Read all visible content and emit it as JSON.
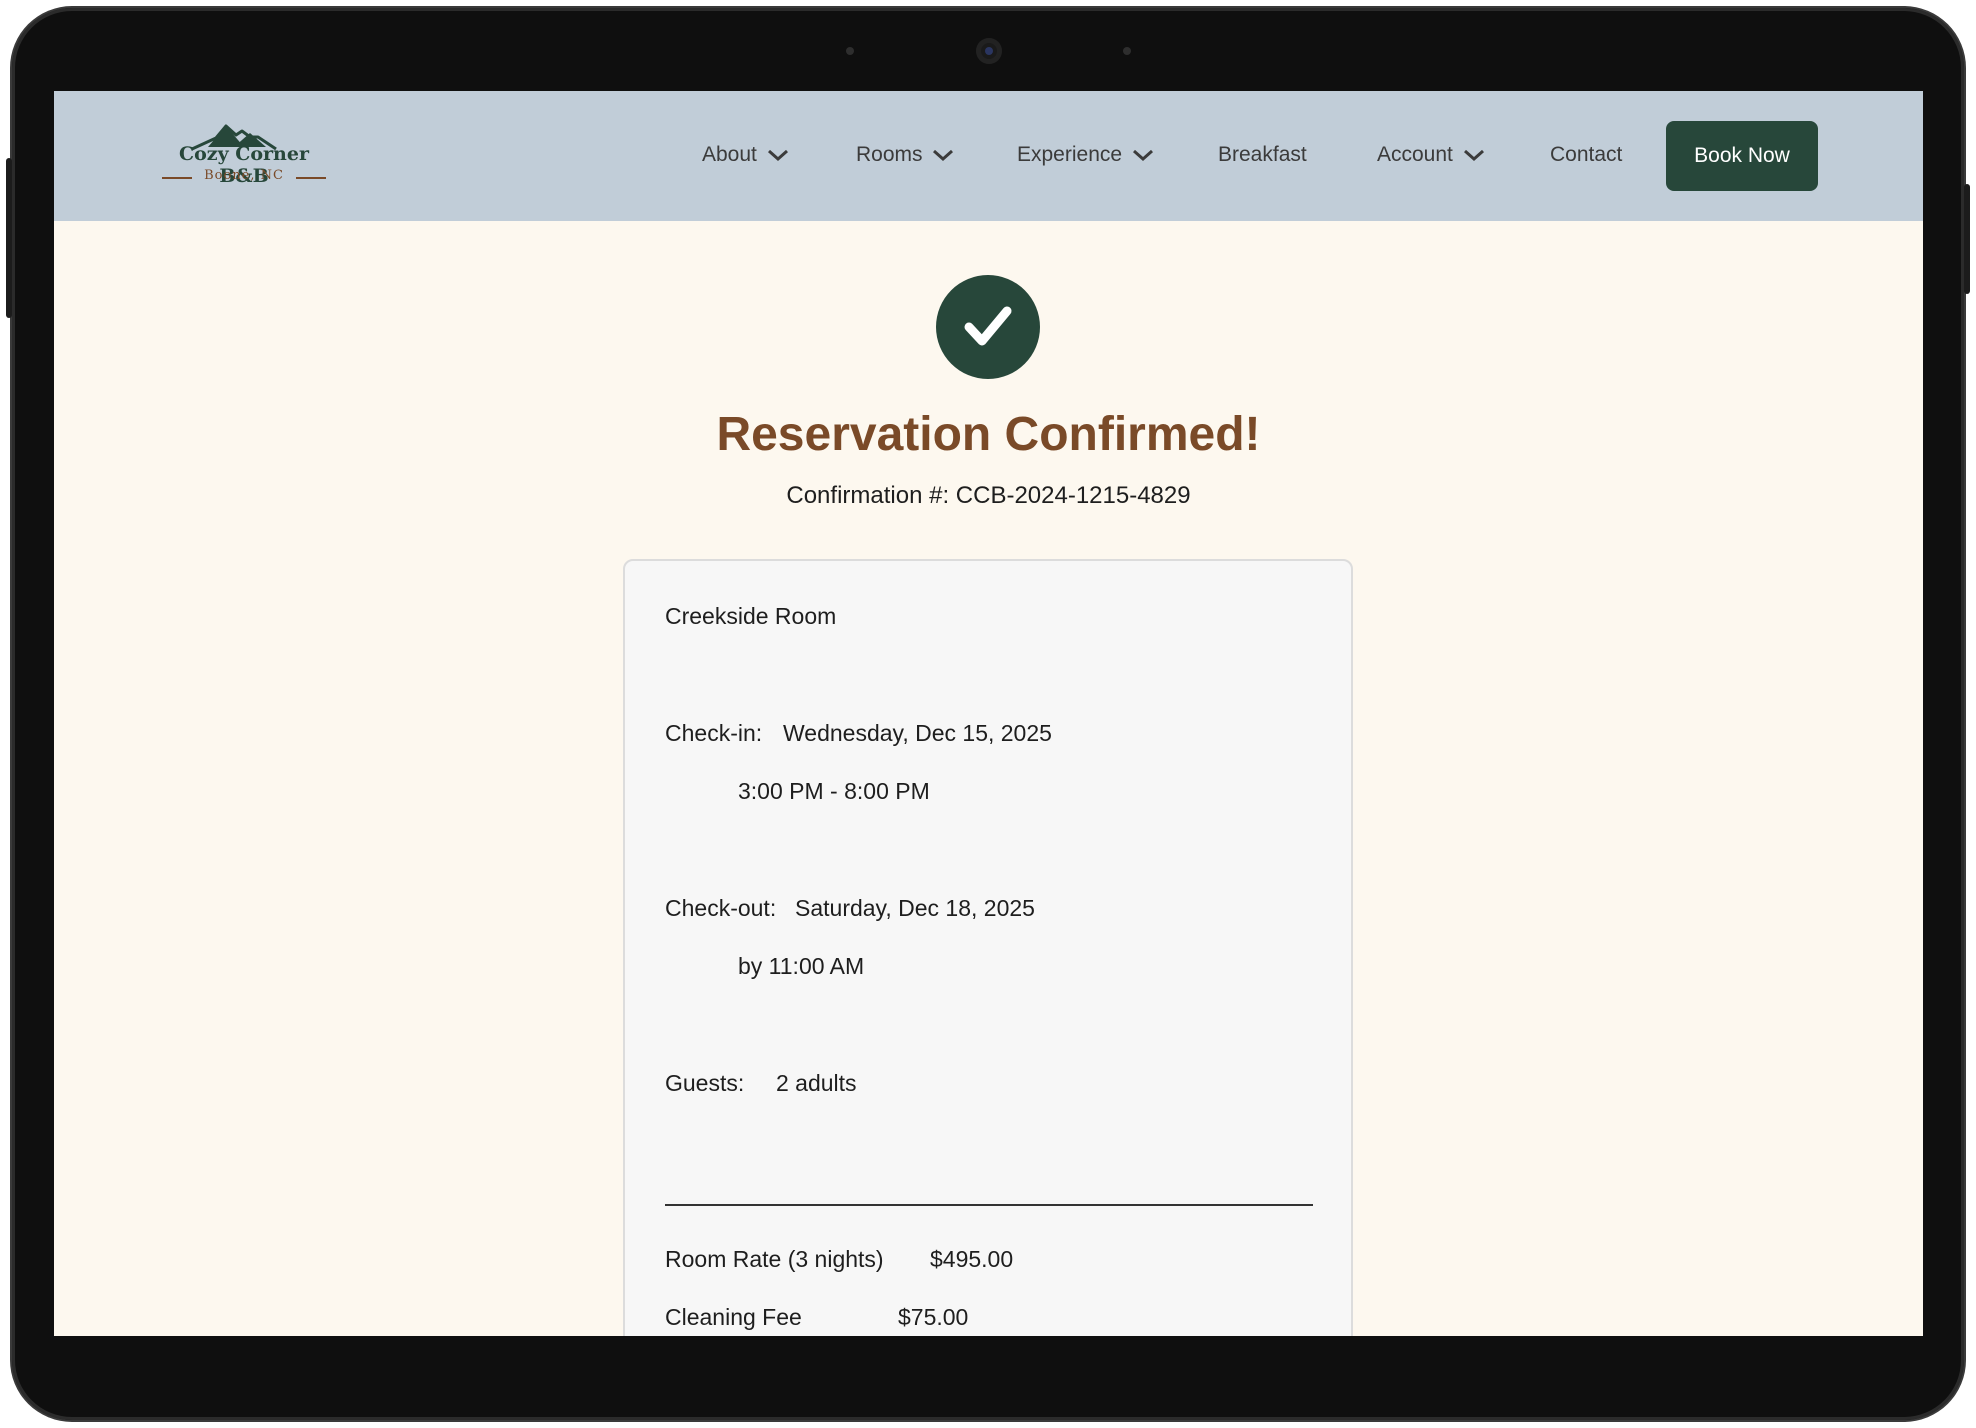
{
  "nav": {
    "brand_name": "Cozy Corner B&B",
    "brand_location": "Boone, NC",
    "items": [
      {
        "label": "About",
        "dropdown": true
      },
      {
        "label": "Rooms",
        "dropdown": true
      },
      {
        "label": "Experience",
        "dropdown": true
      },
      {
        "label": "Breakfast",
        "dropdown": false
      },
      {
        "label": "Account",
        "dropdown": true
      },
      {
        "label": "Contact",
        "dropdown": false
      }
    ],
    "cta_label": "Book Now"
  },
  "confirmation": {
    "icon": "check-circle-icon",
    "title": "Reservation Confirmed!",
    "number_text": "Confirmation #: CCB-2024-1215-4829"
  },
  "details": {
    "room_name": "Creekside Room",
    "checkin_label": "Check-in:",
    "checkin_date": "Wednesday, Dec 15, 2025",
    "checkin_time": "3:00 PM - 8:00 PM",
    "checkout_label": "Check-out:",
    "checkout_date": "Saturday, Dec 18, 2025",
    "checkout_time": "by 11:00 AM",
    "guests_label": "Guests:",
    "guests_value": "2 adults",
    "charges": [
      {
        "label": "Room Rate (3 nights)",
        "amount": "$495.00"
      },
      {
        "label": "Cleaning Fee",
        "amount": "$75.00"
      }
    ]
  },
  "colors": {
    "accent": "#27473a",
    "title_brown": "#7a4a28",
    "nav_bg": "#c1cdd8",
    "page_bg": "#fdf8ef",
    "card_bg": "#f7f7f7"
  }
}
